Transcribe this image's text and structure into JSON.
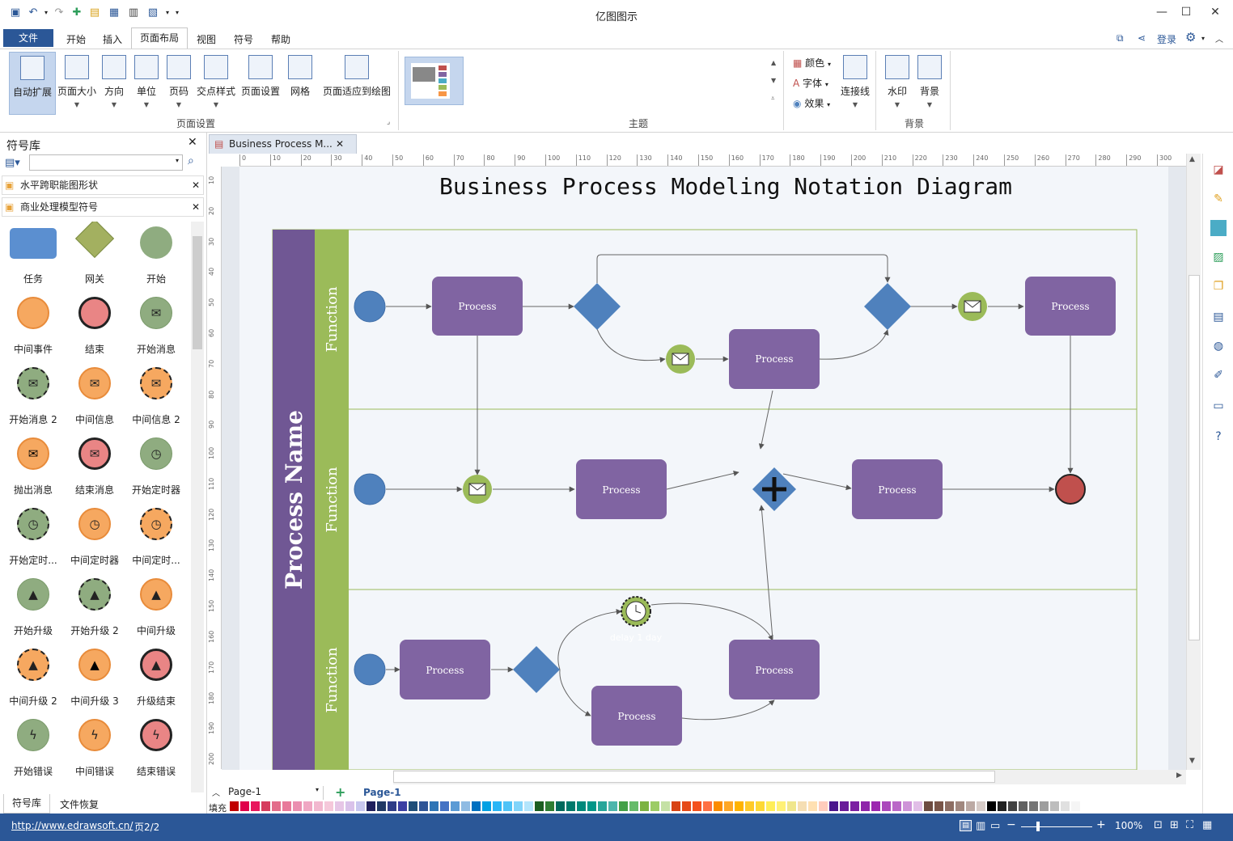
{
  "app": {
    "title": "亿图图示"
  },
  "menu": {
    "file": "文件",
    "items": [
      "开始",
      "插入",
      "页面布局",
      "视图",
      "符号",
      "帮助"
    ],
    "login": "登录"
  },
  "ribbon": {
    "page_setup": [
      "自动扩展",
      "页面大小",
      "方向",
      "单位",
      "页码",
      "交点样式",
      "页面设置",
      "网格",
      "页面适应到绘图"
    ],
    "page_setup_group": "页面设置",
    "theme_group": "主题",
    "theme_items": [
      "颜色",
      "字体",
      "效果"
    ],
    "connector": "连接线",
    "bg": [
      "水印",
      "背景"
    ],
    "bg_group": "背景"
  },
  "library": {
    "title": "符号库",
    "rows": [
      "水平跨职能图形状",
      "商业处理模型符号"
    ],
    "shapes": [
      "任务",
      "网关",
      "开始",
      "中间事件",
      "结束",
      "开始消息",
      "开始消息 2",
      "中间信息",
      "中间信息 2",
      "抛出消息",
      "结束消息",
      "开始定时器",
      "开始定时...",
      "中间定时器",
      "中间定时...",
      "开始升级",
      "开始升级 2",
      "中间升级",
      "中间升级 2",
      "中间升级 3",
      "升级结束",
      "开始错误",
      "中间错误",
      "结束错误"
    ],
    "bottom_tabs": [
      "符号库",
      "文件恢复"
    ]
  },
  "document": {
    "tab": "Business Process M...",
    "title": "Business Process Modeling Notation Diagram",
    "pool": "Process Name",
    "lanes": [
      "Function",
      "Function",
      "Function"
    ],
    "process": "Process",
    "timer_label": "delay 1 day"
  },
  "ruler": {
    "h": [
      "0",
      "10",
      "20",
      "30",
      "40",
      "50",
      "60",
      "70",
      "80",
      "90",
      "100",
      "110",
      "120",
      "130",
      "140",
      "150",
      "160",
      "170",
      "180",
      "190",
      "200",
      "210",
      "220",
      "230",
      "240",
      "250",
      "260",
      "270",
      "280",
      "290",
      "300"
    ],
    "v": [
      "10",
      "20",
      "30",
      "40",
      "50",
      "60",
      "70",
      "80",
      "90",
      "100",
      "110",
      "120",
      "130",
      "140",
      "150",
      "160",
      "170",
      "180",
      "190",
      "200"
    ]
  },
  "pages": {
    "select": "Page-1",
    "active": "Page-1",
    "fill": "填充"
  },
  "status": {
    "url": "http://www.edrawsoft.cn/",
    "page": "页2/2",
    "zoom": "100%"
  },
  "colors": {
    "accent": "#2b5797",
    "process": "#8064a2",
    "event": "#4f81bd",
    "lane": "#9bbb59",
    "pool": "#705794",
    "end": "#c0504d"
  },
  "palette": [
    "#c00000",
    "#e0004a",
    "#e8175d",
    "#d63c5e",
    "#e36c8a",
    "#e8799a",
    "#eb8fb0",
    "#f0a7c3",
    "#f2b8cf",
    "#f5c8da",
    "#e6c6e6",
    "#d9c2ea",
    "#c8c7ef",
    "#1f1f5c",
    "#203864",
    "#2e3c87",
    "#3a3ea3",
    "#1f4e79",
    "#2f5597",
    "#2e75b6",
    "#4472c4",
    "#5b9bd5",
    "#8fbbe3",
    "#0070c0",
    "#00a0e3",
    "#29b6f6",
    "#4fc3f7",
    "#81d4fa",
    "#b3e5fc",
    "#1b5e20",
    "#2e7d32",
    "#00695c",
    "#00796b",
    "#00897b",
    "#009688",
    "#26a69a",
    "#4db6ac",
    "#43a047",
    "#66bb6a",
    "#7cb342",
    "#9ccc65",
    "#c5e1a5",
    "#d84315",
    "#e64a19",
    "#f4511e",
    "#ff7043",
    "#fb8c00",
    "#ffa726",
    "#ffb300",
    "#ffca28",
    "#fdd835",
    "#ffee58",
    "#fff176",
    "#f0e68c",
    "#f5deb3",
    "#ffe0b2",
    "#ffccbc",
    "#4a148c",
    "#6a1b9a",
    "#7b1fa2",
    "#8e24aa",
    "#9c27b0",
    "#ab47bc",
    "#ba68c8",
    "#ce93d8",
    "#e1bee7",
    "#6d4c41",
    "#795548",
    "#8d6e63",
    "#a1887f",
    "#bcaaa4",
    "#d7ccc8",
    "#000000",
    "#212121",
    "#424242",
    "#616161",
    "#757575",
    "#9e9e9e",
    "#bdbdbd",
    "#e0e0e0",
    "#f5f5f5"
  ]
}
